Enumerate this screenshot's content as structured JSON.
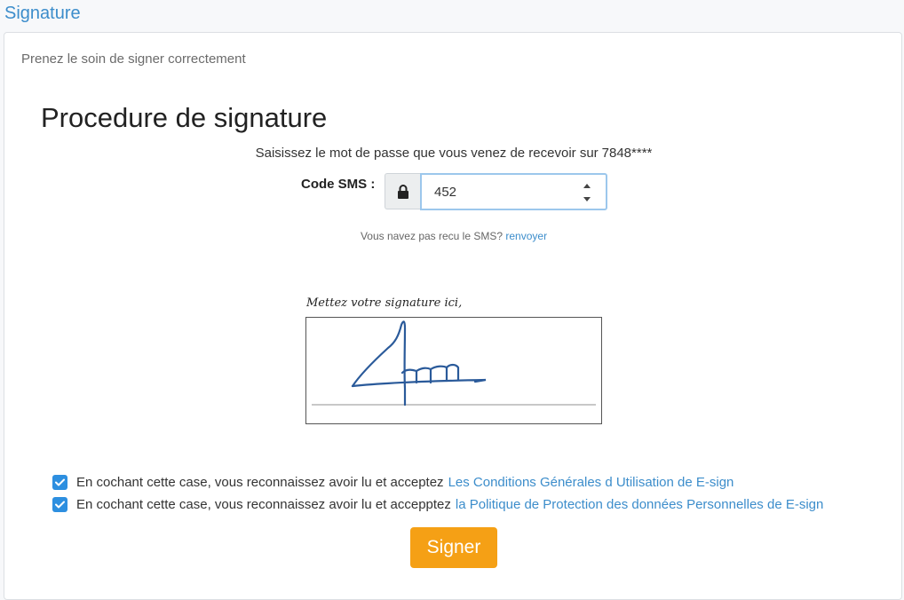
{
  "header": {
    "title": "Signature"
  },
  "panel": {
    "subtitle": "Prenez le soin de signer correctement",
    "heading": "Procedure de signature",
    "instruction": "Saisissez le mot de passe que vous venez de recevoir sur",
    "phone_masked": "7848****",
    "sms": {
      "label": "Code SMS :",
      "value": "452",
      "lock_icon": "lock-icon"
    },
    "resend": {
      "text": "Vous navez pas recu le SMS?",
      "link": "renvoyer"
    },
    "signature": {
      "caption": "Mettez votre signature ici,"
    },
    "terms": [
      {
        "checked": true,
        "text": "En cochant cette case, vous reconnaissez avoir lu et acceptez",
        "link": "Les Conditions Générales d Utilisation de E-sign"
      },
      {
        "checked": true,
        "text": "En cochant cette case, vous reconnaissez avoir lu et accepptez",
        "link": "la Politique de Protection des données Personnelles de E-sign"
      }
    ],
    "sign_button": "Signer"
  },
  "colors": {
    "accent": "#3c8dcb",
    "button": "#f5a015",
    "checkbox": "#2d8fe0",
    "ink": "#2a5a9a"
  }
}
